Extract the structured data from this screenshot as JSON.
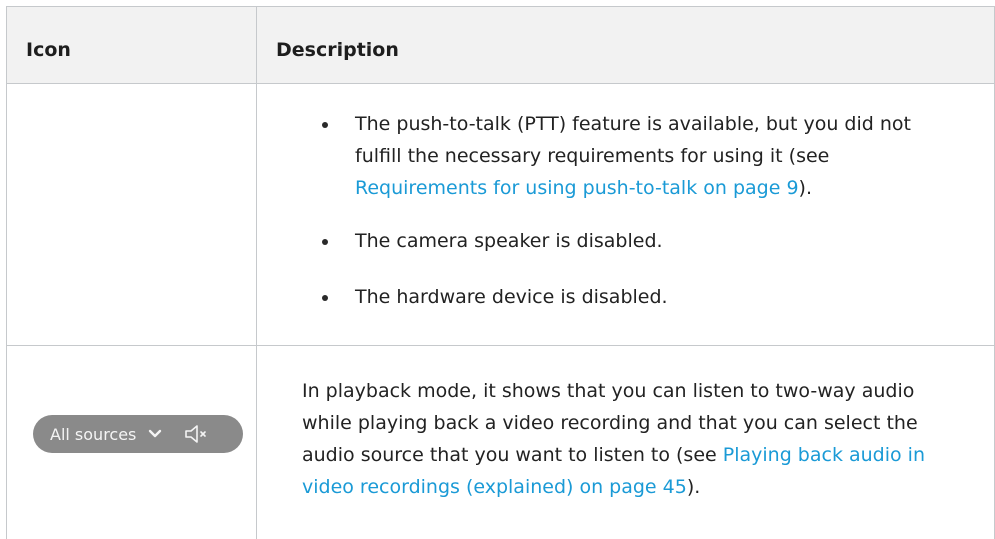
{
  "table": {
    "headers": {
      "icon": "Icon",
      "description": "Description"
    },
    "row1": {
      "bullets": [
        {
          "text_before": "The push-to-talk (PTT) feature is available, but you did not fulfill the necessary requirements for using it (see ",
          "link": "Requirements for using push-to-talk on page 9",
          "text_after": ")."
        },
        {
          "text_before": "The camera speaker is disabled."
        },
        {
          "text_before": "The hardware device is disabled."
        }
      ]
    },
    "row2": {
      "icon_widget": {
        "label": "All sources",
        "chevron_icon": "chevron-down-icon",
        "speaker_icon": "speaker-muted-icon"
      },
      "text_before": "In playback mode, it shows that you can listen to two-way audio while playing back a video recording and that you can select the audio source that you want to listen to (see ",
      "link": "Playing back audio in video recordings (explained) on page 45",
      "text_after": ")."
    }
  },
  "colors": {
    "link": "#1a9ad6",
    "header_bg": "#f2f2f2",
    "border": "#c6c9cc",
    "pill_bg": "#8a8a8a"
  }
}
